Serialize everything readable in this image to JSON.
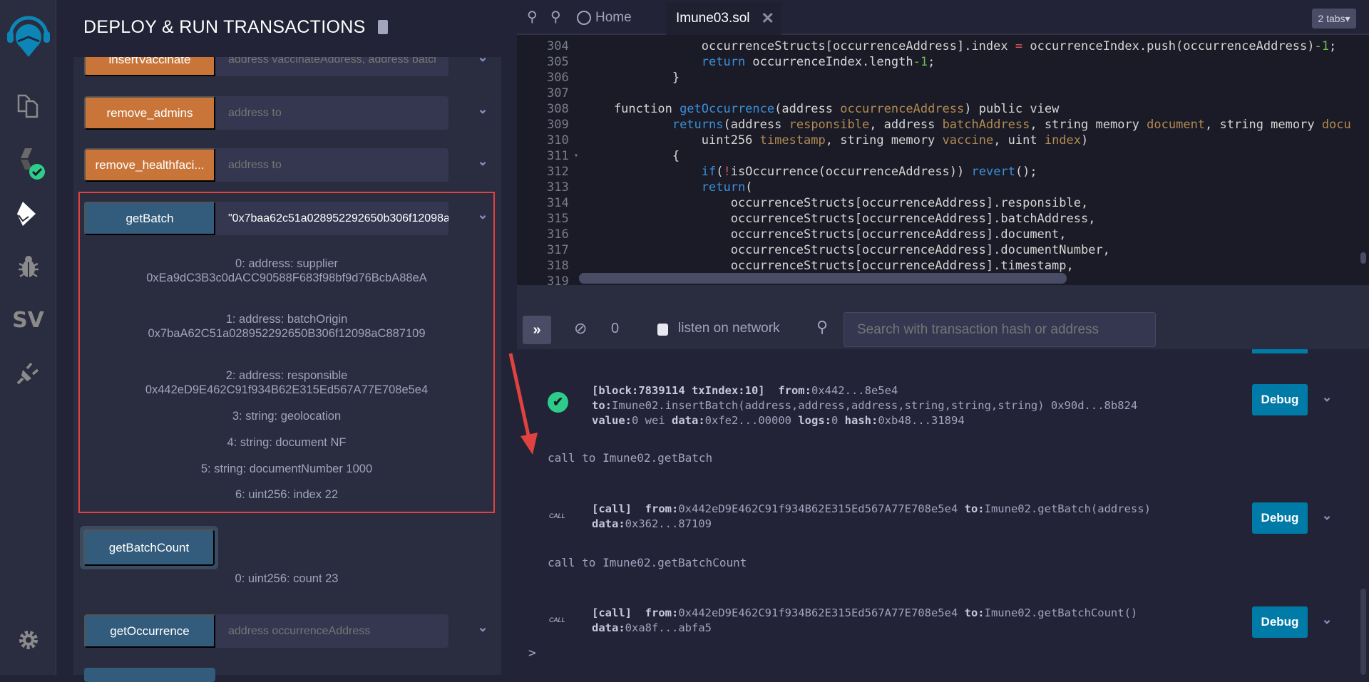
{
  "iconbar": {
    "items": [
      {
        "name": "remix-logo-icon"
      },
      {
        "name": "file-explorer-icon"
      },
      {
        "name": "solidity-compiler-icon"
      },
      {
        "name": "deploy-run-icon"
      },
      {
        "name": "debugger-icon"
      },
      {
        "name": "solidity-verify-icon",
        "label": "SV"
      },
      {
        "name": "plugin-manager-icon"
      },
      {
        "name": "settings-icon"
      }
    ]
  },
  "panel": {
    "title": "DEPLOY & RUN TRANSACTIONS",
    "functions": [
      {
        "label": "insertVaccinate",
        "placeholder": "address vaccinateAddress, address batchAddr",
        "value": "",
        "color": "orange"
      },
      {
        "label": "remove_admins",
        "placeholder": "address to",
        "value": "",
        "color": "orange"
      },
      {
        "label": "remove_healthfaci...",
        "placeholder": "address to",
        "value": "",
        "color": "orange"
      },
      {
        "label": "getBatch",
        "placeholder": "",
        "value": "\"0x7baa62c51a028952292650b306f12098a",
        "color": "blue"
      }
    ],
    "getBatch_results": [
      {
        "line1": "0: address: supplier",
        "line2": "0xEa9dC3B3c0dACC90588F683f98bf9d76BcbA88eA"
      },
      {
        "line1": "1: address: batchOrigin",
        "line2": "0x7baA62C51a028952292650B306f12098aC887109"
      },
      {
        "line1": "2: address: responsible",
        "line2": "0x442eD9E462C91f934B62E315Ed567A77E708e5e4"
      },
      {
        "line1": "3: string: geolocation"
      },
      {
        "line1": "4: string: document NF"
      },
      {
        "line1": "5: string: documentNumber 1000"
      },
      {
        "line1": "6: uint256: index 22"
      }
    ],
    "getBatchCount": {
      "label": "getBatchCount",
      "result": "0: uint256: count 23"
    },
    "getOccurrence": {
      "label": "getOccurrence",
      "placeholder": "address occurrenceAddress"
    }
  },
  "editor": {
    "home_tab": "Home",
    "file_tab": "Imune03.sol",
    "tabs_count": "2 tabs",
    "lines": [
      {
        "n": "304",
        "tokens": [
          {
            "t": "                occurrenceStructs[occurrenceAddress].index "
          },
          {
            "t": "=",
            "c": "op"
          },
          {
            "t": " occurrenceIndex.push(occurrenceAddress)"
          },
          {
            "t": "-1",
            "c": "num"
          },
          {
            "t": ";"
          }
        ]
      },
      {
        "n": "305",
        "tokens": [
          {
            "t": "                "
          },
          {
            "t": "return",
            "c": "kw"
          },
          {
            "t": " occurrenceIndex.length"
          },
          {
            "t": "-1",
            "c": "num"
          },
          {
            "t": ";"
          }
        ]
      },
      {
        "n": "306",
        "tokens": [
          {
            "t": "            }"
          }
        ]
      },
      {
        "n": "307",
        "tokens": []
      },
      {
        "n": "308",
        "tokens": [
          {
            "t": "    function "
          },
          {
            "t": "getOccurrence",
            "c": "fn"
          },
          {
            "t": "(address "
          },
          {
            "t": "occurrenceAddress",
            "c": "param"
          },
          {
            "t": ") public view"
          }
        ]
      },
      {
        "n": "309",
        "tokens": [
          {
            "t": "            "
          },
          {
            "t": "returns",
            "c": "kw"
          },
          {
            "t": "(address "
          },
          {
            "t": "responsible",
            "c": "param"
          },
          {
            "t": ", address "
          },
          {
            "t": "batchAddress",
            "c": "param"
          },
          {
            "t": ", string memory "
          },
          {
            "t": "document",
            "c": "param"
          },
          {
            "t": ", string memory "
          },
          {
            "t": "docu",
            "c": "param"
          }
        ]
      },
      {
        "n": "310",
        "tokens": [
          {
            "t": "                uint256 "
          },
          {
            "t": "timestamp",
            "c": "param"
          },
          {
            "t": ", string memory "
          },
          {
            "t": "vaccine",
            "c": "param"
          },
          {
            "t": ", uint "
          },
          {
            "t": "index",
            "c": "param"
          },
          {
            "t": ")"
          }
        ]
      },
      {
        "n": "311",
        "fold": true,
        "tokens": [
          {
            "t": "            {"
          }
        ]
      },
      {
        "n": "312",
        "tokens": [
          {
            "t": "                "
          },
          {
            "t": "if",
            "c": "kw"
          },
          {
            "t": "("
          },
          {
            "t": "!",
            "c": "op"
          },
          {
            "t": "isOccurrence(occurrenceAddress)) "
          },
          {
            "t": "revert",
            "c": "kw"
          },
          {
            "t": "();"
          }
        ]
      },
      {
        "n": "313",
        "tokens": [
          {
            "t": "                "
          },
          {
            "t": "return",
            "c": "kw"
          },
          {
            "t": "("
          }
        ]
      },
      {
        "n": "314",
        "tokens": [
          {
            "t": "                    occurrenceStructs[occurrenceAddress].responsible,"
          }
        ]
      },
      {
        "n": "315",
        "tokens": [
          {
            "t": "                    occurrenceStructs[occurrenceAddress].batchAddress,"
          }
        ]
      },
      {
        "n": "316",
        "tokens": [
          {
            "t": "                    occurrenceStructs[occurrenceAddress].document,"
          }
        ]
      },
      {
        "n": "317",
        "tokens": [
          {
            "t": "                    occurrenceStructs[occurrenceAddress].documentNumber,"
          }
        ]
      },
      {
        "n": "318",
        "tokens": [
          {
            "t": "                    occurrenceStructs[occurrenceAddress].timestamp,"
          }
        ]
      },
      {
        "n": "319",
        "tokens": []
      }
    ]
  },
  "terminal": {
    "pending_count": "0",
    "listen_label": "listen on network",
    "listen_checked": false,
    "search_placeholder": "Search with transaction hash or address",
    "debug_label": "Debug",
    "call_badge": "CALL",
    "prompt": ">",
    "entries": [
      {
        "type": "tx",
        "status": "success",
        "lines": [
          [
            {
              "k": "[block:7839114 txIndex:10]"
            },
            {
              "t": "  "
            },
            {
              "k": "from:"
            },
            {
              "t": "0x442...8e5e4"
            }
          ],
          [
            {
              "k": "to:"
            },
            {
              "t": "Imune02.insertBatch(address,address,address,string,string,string) 0x90d...8b824"
            }
          ],
          [
            {
              "k": "value:"
            },
            {
              "t": "0 wei "
            },
            {
              "k": "data:"
            },
            {
              "t": "0xfe2...00000 "
            },
            {
              "k": "logs:"
            },
            {
              "t": "0 "
            },
            {
              "k": "hash:"
            },
            {
              "t": "0xb48...31894"
            }
          ]
        ]
      },
      {
        "type": "note",
        "text": "call to Imune02.getBatch"
      },
      {
        "type": "call",
        "lines": [
          [
            {
              "k": "[call]"
            },
            {
              "t": "  "
            },
            {
              "k": "from:"
            },
            {
              "t": "0x442eD9E462C91f934B62E315Ed567A77E708e5e4 "
            },
            {
              "k": "to:"
            },
            {
              "t": "Imune02.getBatch(address)"
            }
          ],
          [
            {
              "k": "data:"
            },
            {
              "t": "0x362...87109"
            }
          ]
        ]
      },
      {
        "type": "note",
        "text": "call to Imune02.getBatchCount"
      },
      {
        "type": "call",
        "lines": [
          [
            {
              "k": "[call]"
            },
            {
              "t": "  "
            },
            {
              "k": "from:"
            },
            {
              "t": "0x442eD9E462C91f934B62E315Ed567A77E708e5e4 "
            },
            {
              "k": "to:"
            },
            {
              "t": "Imune02.getBatchCount()"
            }
          ],
          [
            {
              "k": "data:"
            },
            {
              "t": "0xa8f...abfa5"
            }
          ]
        ]
      }
    ]
  },
  "colors": {
    "orange": "#c97539",
    "blue": "#335c7c",
    "debug": "#007aa6",
    "success": "#2ecc8a",
    "highlight": "#e0433f"
  }
}
